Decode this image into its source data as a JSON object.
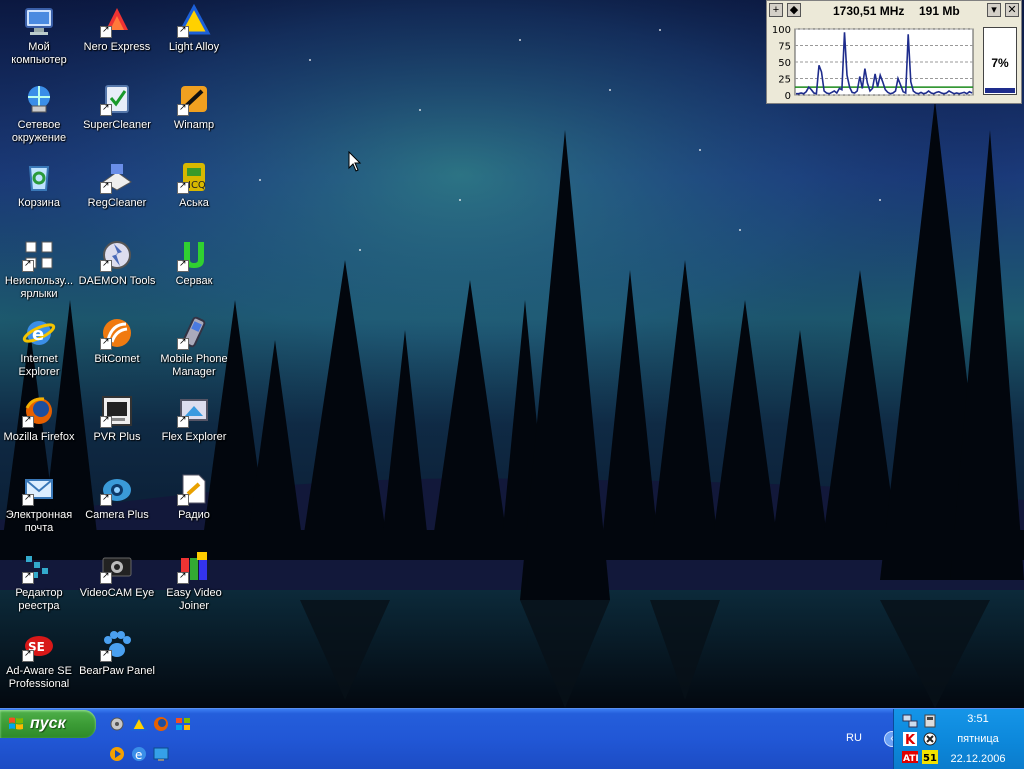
{
  "desktop": {
    "icons": [
      {
        "name": "my-computer",
        "label": "Мой компьютер",
        "icon": "computer-icon"
      },
      {
        "name": "nero-express",
        "label": "Nero Express",
        "icon": "nero-icon"
      },
      {
        "name": "light-alloy",
        "label": "Light Alloy",
        "icon": "light-alloy-icon"
      },
      {
        "name": "network",
        "label": "Сетевое окружение",
        "icon": "network-icon"
      },
      {
        "name": "supercleaner",
        "label": "SuperCleaner",
        "icon": "supercleaner-icon"
      },
      {
        "name": "winamp",
        "label": "Winamp",
        "icon": "winamp-icon"
      },
      {
        "name": "recycle-bin",
        "label": "Корзина",
        "icon": "recycle-bin-icon"
      },
      {
        "name": "regcleaner",
        "label": "RegCleaner",
        "icon": "regcleaner-icon"
      },
      {
        "name": "icq",
        "label": "Аська",
        "icon": "icq-icon"
      },
      {
        "name": "unused-shortcuts",
        "label": "Неиспользу... ярлыки",
        "icon": "unused-shortcuts-icon"
      },
      {
        "name": "daemon-tools",
        "label": "DAEMON Tools",
        "icon": "daemon-tools-icon"
      },
      {
        "name": "servak",
        "label": "Сервак",
        "icon": "servak-icon"
      },
      {
        "name": "internet-explorer",
        "label": "Internet Explorer",
        "icon": "ie-icon"
      },
      {
        "name": "bitcomet",
        "label": "BitComet",
        "icon": "bitcomet-icon"
      },
      {
        "name": "mobile-phone-manager",
        "label": "Mobile Phone Manager",
        "icon": "phone-icon"
      },
      {
        "name": "mozilla-firefox",
        "label": "Mozilla Firefox",
        "icon": "firefox-icon"
      },
      {
        "name": "pvr-plus",
        "label": "PVR Plus",
        "icon": "pvr-icon"
      },
      {
        "name": "flex-explorer",
        "label": "Flex Explorer",
        "icon": "flex-explorer-icon"
      },
      {
        "name": "email",
        "label": "Электронная почта",
        "icon": "email-icon"
      },
      {
        "name": "camera-plus",
        "label": "Camera Plus",
        "icon": "camera-icon"
      },
      {
        "name": "radio",
        "label": "Радио",
        "icon": "radio-icon"
      },
      {
        "name": "registry-editor",
        "label": "Редактор реестра",
        "icon": "regedit-icon"
      },
      {
        "name": "videocam-eye",
        "label": "VideoCAM Eye",
        "icon": "videocam-icon"
      },
      {
        "name": "easy-video-joiner",
        "label": "Easy Video Joiner",
        "icon": "video-joiner-icon"
      },
      {
        "name": "ad-aware",
        "label": "Ad-Aware SE Professional",
        "icon": "ad-aware-icon"
      },
      {
        "name": "bearpaw-panel",
        "label": "BearPaw Panel",
        "icon": "bearpaw-icon"
      }
    ]
  },
  "cpu_widget": {
    "frequency": "1730,51 MHz",
    "memory": "191 Mb",
    "usage_label": "7%",
    "usage_value": 7,
    "y_ticks": [
      "100",
      "75",
      "50",
      "25",
      "0"
    ],
    "history": [
      2,
      2,
      3,
      2,
      5,
      12,
      8,
      3,
      2,
      45,
      35,
      6,
      3,
      2,
      4,
      6,
      3,
      10,
      8,
      95,
      30,
      12,
      4,
      3,
      6,
      28,
      10,
      40,
      18,
      6,
      10,
      32,
      12,
      30,
      20,
      8,
      4,
      2,
      3,
      6,
      25,
      15,
      5,
      3,
      92,
      20,
      6,
      3,
      2,
      4,
      2,
      3,
      6,
      3,
      2,
      4,
      5,
      3,
      2,
      3,
      6,
      4,
      2,
      3,
      2,
      3,
      4,
      2,
      5,
      3
    ],
    "baseline": 12
  },
  "taskbar": {
    "start_label": "пуск",
    "language": "RU",
    "clock": {
      "time": "3:51",
      "day": "пятница",
      "date": "22.12.2006"
    },
    "tray_badge": "51"
  },
  "colors": {
    "graph_line": "#1e2c8c",
    "graph_baseline": "#1a8a1a",
    "taskbar": "#245edb",
    "start": "#3c9c36"
  }
}
